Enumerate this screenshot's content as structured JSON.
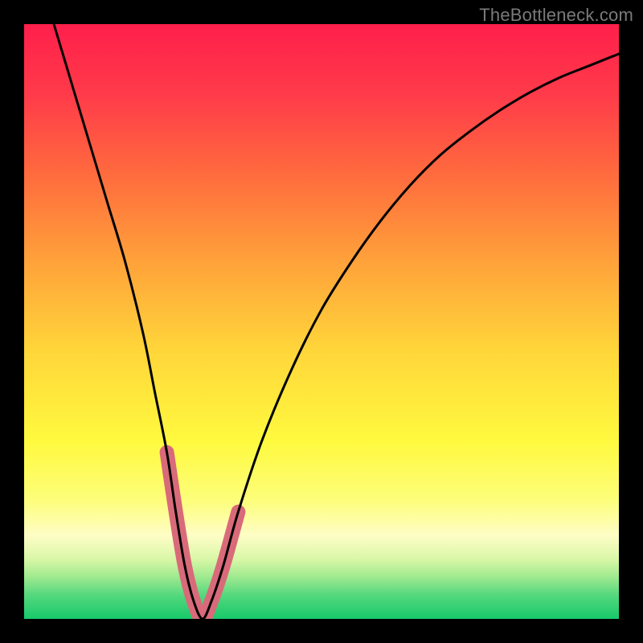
{
  "watermark": "TheBottleneck.com",
  "chart_data": {
    "type": "line",
    "title": "",
    "xlabel": "",
    "ylabel": "",
    "xlim": [
      0,
      100
    ],
    "ylim": [
      0,
      100
    ],
    "series": [
      {
        "name": "bottleneck-curve",
        "x": [
          5,
          8,
          11,
          14,
          17,
          20,
          22,
          24,
          25.5,
          27,
          28.5,
          30,
          31.5,
          33.5,
          36,
          40,
          45,
          50,
          55,
          60,
          65,
          70,
          75,
          80,
          85,
          90,
          95,
          100
        ],
        "values": [
          100,
          90,
          80,
          70,
          60,
          48,
          38,
          28,
          18,
          9,
          3,
          0,
          3,
          9,
          18,
          30,
          42,
          52,
          60,
          67,
          73,
          78,
          82,
          85.5,
          88.5,
          91,
          93,
          95
        ]
      },
      {
        "name": "highlight-band",
        "x": [
          24,
          25.5,
          27,
          28.5,
          30,
          31.5,
          33.5,
          36
        ],
        "values": [
          28,
          18,
          9,
          3,
          0,
          3,
          9,
          18
        ]
      }
    ],
    "gradient_stops": [
      {
        "offset": 0.0,
        "color": "#ff1f4b"
      },
      {
        "offset": 0.12,
        "color": "#ff3b4a"
      },
      {
        "offset": 0.25,
        "color": "#ff6a3e"
      },
      {
        "offset": 0.4,
        "color": "#ffa23a"
      },
      {
        "offset": 0.55,
        "color": "#ffd63a"
      },
      {
        "offset": 0.7,
        "color": "#fff93e"
      },
      {
        "offset": 0.8,
        "color": "#fdfe7a"
      },
      {
        "offset": 0.86,
        "color": "#fefdc6"
      },
      {
        "offset": 0.9,
        "color": "#d8f7a6"
      },
      {
        "offset": 0.93,
        "color": "#9ee98f"
      },
      {
        "offset": 0.96,
        "color": "#55d87e"
      },
      {
        "offset": 1.0,
        "color": "#17c96a"
      }
    ]
  }
}
